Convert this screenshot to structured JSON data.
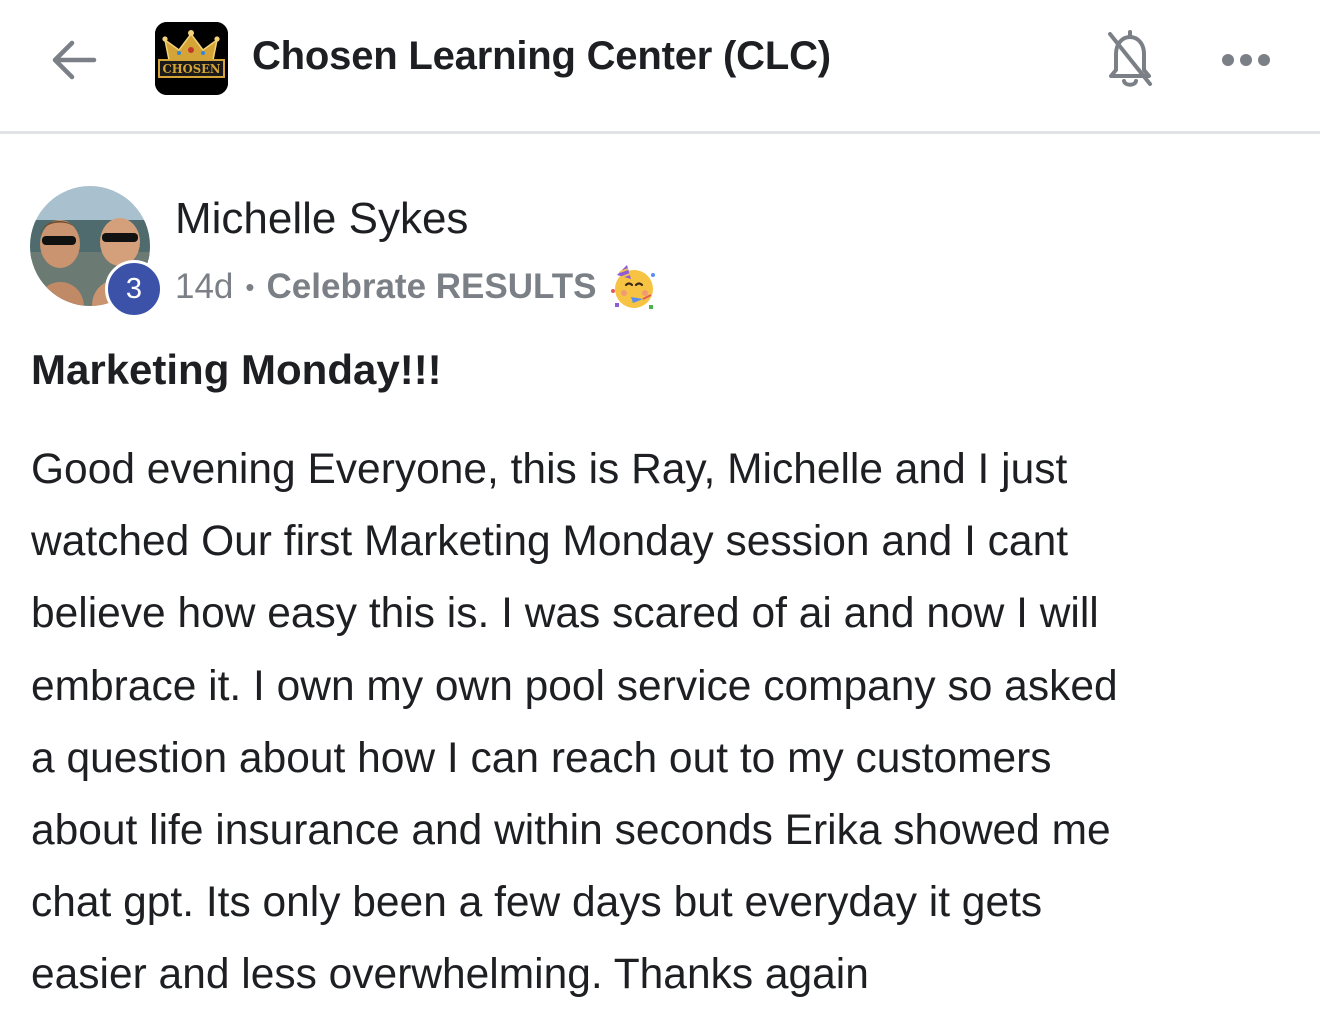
{
  "header": {
    "title": "Chosen Learning Center (CLC)",
    "logo_text": "CHOSEN",
    "icons": {
      "back": "arrow-left-icon",
      "notifications": "bell-off-icon",
      "more": "more-horizontal-icon"
    }
  },
  "post": {
    "author": "Michelle Sykes",
    "level": "3",
    "time_ago": "14d",
    "separator": "•",
    "category": "Celebrate RESULTS",
    "category_icon": "partying-face-emoji",
    "title": "Marketing Monday!!!",
    "body_lines": [
      "Good evening Everyone, this is Ray, Michelle and I just",
      "watched Our first Marketing Monday session and I cant",
      "believe how easy this is. I was scared of ai and now I will",
      "embrace it. I own my own pool service company so asked",
      "a question about how I can reach out to my customers",
      "about life insurance and within seconds Erika showed me",
      "chat gpt. Its only been a few days but everyday it gets",
      "easier and less overwhelming. Thanks again"
    ]
  },
  "colors": {
    "level_badge": "#3c52a8",
    "muted_text": "#7b7f86",
    "text": "#1d1f22",
    "divider": "#e2e3e6"
  }
}
